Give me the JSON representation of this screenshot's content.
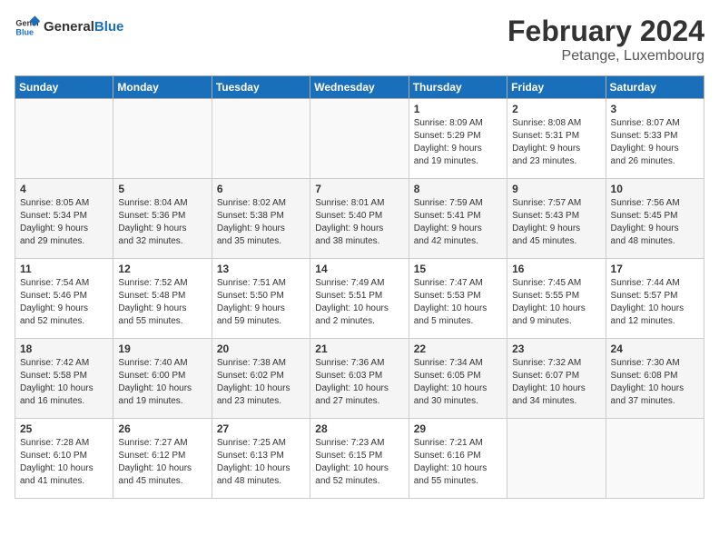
{
  "header": {
    "logo_general": "General",
    "logo_blue": "Blue",
    "title": "February 2024",
    "location": "Petange, Luxembourg"
  },
  "weekdays": [
    "Sunday",
    "Monday",
    "Tuesday",
    "Wednesday",
    "Thursday",
    "Friday",
    "Saturday"
  ],
  "weeks": [
    [
      {
        "day": "",
        "info": ""
      },
      {
        "day": "",
        "info": ""
      },
      {
        "day": "",
        "info": ""
      },
      {
        "day": "",
        "info": ""
      },
      {
        "day": "1",
        "info": "Sunrise: 8:09 AM\nSunset: 5:29 PM\nDaylight: 9 hours\nand 19 minutes."
      },
      {
        "day": "2",
        "info": "Sunrise: 8:08 AM\nSunset: 5:31 PM\nDaylight: 9 hours\nand 23 minutes."
      },
      {
        "day": "3",
        "info": "Sunrise: 8:07 AM\nSunset: 5:33 PM\nDaylight: 9 hours\nand 26 minutes."
      }
    ],
    [
      {
        "day": "4",
        "info": "Sunrise: 8:05 AM\nSunset: 5:34 PM\nDaylight: 9 hours\nand 29 minutes."
      },
      {
        "day": "5",
        "info": "Sunrise: 8:04 AM\nSunset: 5:36 PM\nDaylight: 9 hours\nand 32 minutes."
      },
      {
        "day": "6",
        "info": "Sunrise: 8:02 AM\nSunset: 5:38 PM\nDaylight: 9 hours\nand 35 minutes."
      },
      {
        "day": "7",
        "info": "Sunrise: 8:01 AM\nSunset: 5:40 PM\nDaylight: 9 hours\nand 38 minutes."
      },
      {
        "day": "8",
        "info": "Sunrise: 7:59 AM\nSunset: 5:41 PM\nDaylight: 9 hours\nand 42 minutes."
      },
      {
        "day": "9",
        "info": "Sunrise: 7:57 AM\nSunset: 5:43 PM\nDaylight: 9 hours\nand 45 minutes."
      },
      {
        "day": "10",
        "info": "Sunrise: 7:56 AM\nSunset: 5:45 PM\nDaylight: 9 hours\nand 48 minutes."
      }
    ],
    [
      {
        "day": "11",
        "info": "Sunrise: 7:54 AM\nSunset: 5:46 PM\nDaylight: 9 hours\nand 52 minutes."
      },
      {
        "day": "12",
        "info": "Sunrise: 7:52 AM\nSunset: 5:48 PM\nDaylight: 9 hours\nand 55 minutes."
      },
      {
        "day": "13",
        "info": "Sunrise: 7:51 AM\nSunset: 5:50 PM\nDaylight: 9 hours\nand 59 minutes."
      },
      {
        "day": "14",
        "info": "Sunrise: 7:49 AM\nSunset: 5:51 PM\nDaylight: 10 hours\nand 2 minutes."
      },
      {
        "day": "15",
        "info": "Sunrise: 7:47 AM\nSunset: 5:53 PM\nDaylight: 10 hours\nand 5 minutes."
      },
      {
        "day": "16",
        "info": "Sunrise: 7:45 AM\nSunset: 5:55 PM\nDaylight: 10 hours\nand 9 minutes."
      },
      {
        "day": "17",
        "info": "Sunrise: 7:44 AM\nSunset: 5:57 PM\nDaylight: 10 hours\nand 12 minutes."
      }
    ],
    [
      {
        "day": "18",
        "info": "Sunrise: 7:42 AM\nSunset: 5:58 PM\nDaylight: 10 hours\nand 16 minutes."
      },
      {
        "day": "19",
        "info": "Sunrise: 7:40 AM\nSunset: 6:00 PM\nDaylight: 10 hours\nand 19 minutes."
      },
      {
        "day": "20",
        "info": "Sunrise: 7:38 AM\nSunset: 6:02 PM\nDaylight: 10 hours\nand 23 minutes."
      },
      {
        "day": "21",
        "info": "Sunrise: 7:36 AM\nSunset: 6:03 PM\nDaylight: 10 hours\nand 27 minutes."
      },
      {
        "day": "22",
        "info": "Sunrise: 7:34 AM\nSunset: 6:05 PM\nDaylight: 10 hours\nand 30 minutes."
      },
      {
        "day": "23",
        "info": "Sunrise: 7:32 AM\nSunset: 6:07 PM\nDaylight: 10 hours\nand 34 minutes."
      },
      {
        "day": "24",
        "info": "Sunrise: 7:30 AM\nSunset: 6:08 PM\nDaylight: 10 hours\nand 37 minutes."
      }
    ],
    [
      {
        "day": "25",
        "info": "Sunrise: 7:28 AM\nSunset: 6:10 PM\nDaylight: 10 hours\nand 41 minutes."
      },
      {
        "day": "26",
        "info": "Sunrise: 7:27 AM\nSunset: 6:12 PM\nDaylight: 10 hours\nand 45 minutes."
      },
      {
        "day": "27",
        "info": "Sunrise: 7:25 AM\nSunset: 6:13 PM\nDaylight: 10 hours\nand 48 minutes."
      },
      {
        "day": "28",
        "info": "Sunrise: 7:23 AM\nSunset: 6:15 PM\nDaylight: 10 hours\nand 52 minutes."
      },
      {
        "day": "29",
        "info": "Sunrise: 7:21 AM\nSunset: 6:16 PM\nDaylight: 10 hours\nand 55 minutes."
      },
      {
        "day": "",
        "info": ""
      },
      {
        "day": "",
        "info": ""
      }
    ]
  ]
}
